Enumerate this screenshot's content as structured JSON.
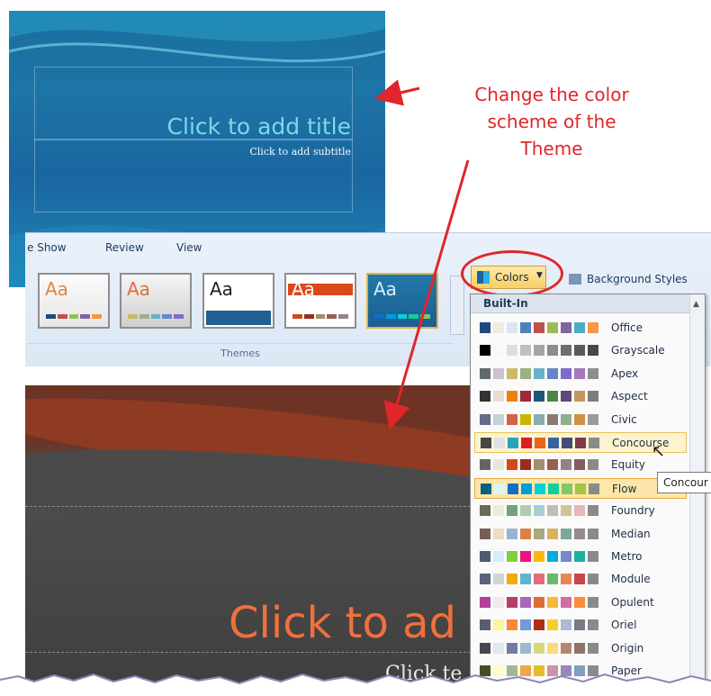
{
  "top_slide": {
    "title": "Click to add title",
    "subtitle": "Click to add subtitle"
  },
  "annotation": {
    "line1": "Change the color",
    "line2": "scheme of the",
    "line3": "Theme",
    "color": "#e0262a"
  },
  "ribbon": {
    "tabs": [
      "e Show",
      "Review",
      "View"
    ],
    "themes_group_label": "Themes",
    "theme_thumbnail_text": "Aa",
    "colors_button_label": "Colors",
    "background_styles_label": "Background Styles"
  },
  "colors_menu": {
    "header": "Built-In",
    "schemes": [
      {
        "name": "Office",
        "colors": [
          "#1f497d",
          "#eeece1",
          "#dbe5f1",
          "#4f81bd",
          "#c0504d",
          "#9bbb59",
          "#8064a2",
          "#4bacc6",
          "#f79646"
        ]
      },
      {
        "name": "Grayscale",
        "colors": [
          "#000000",
          "#f8f8f8",
          "#dddddd",
          "#bfbfbf",
          "#a5a5a5",
          "#8c8c8c",
          "#6e6e6e",
          "#595959",
          "#474747"
        ]
      },
      {
        "name": "Apex",
        "colors": [
          "#5f6b6d",
          "#c9c2d1",
          "#ceb966",
          "#9cb084",
          "#6bb1c9",
          "#6585cf",
          "#7e6bc9",
          "#a379bb",
          "#8e8e8e"
        ]
      },
      {
        "name": "Aspect",
        "colors": [
          "#323232",
          "#e3ded1",
          "#f07f09",
          "#9f2936",
          "#1b587c",
          "#4e8542",
          "#604878",
          "#c19859",
          "#7d7d7d"
        ]
      },
      {
        "name": "Civic",
        "colors": [
          "#646b86",
          "#c5d1d7",
          "#d16349",
          "#ccb400",
          "#8cadae",
          "#8c7b70",
          "#8fb08c",
          "#d19049",
          "#9b9b9b"
        ]
      },
      {
        "name": "Concourse",
        "colors": [
          "#464646",
          "#dee0e4",
          "#2da2bf",
          "#da1f28",
          "#eb641b",
          "#39639d",
          "#474b78",
          "#7d3c4a",
          "#8a8a8a"
        ]
      },
      {
        "name": "Equity",
        "colors": [
          "#696464",
          "#e9e5dc",
          "#d34817",
          "#9b2d1f",
          "#a28e6a",
          "#956251",
          "#918485",
          "#855d5d",
          "#8a8a8a"
        ]
      },
      {
        "name": "Flow",
        "colors": [
          "#04617b",
          "#dbf5f9",
          "#0f6fc6",
          "#009dd9",
          "#0bd0d9",
          "#10cf9b",
          "#7cca62",
          "#a5c249",
          "#8a8a8a"
        ]
      },
      {
        "name": "Foundry",
        "colors": [
          "#676a55",
          "#eaebde",
          "#72a376",
          "#b0ccb0",
          "#a8cdd7",
          "#c0beaf",
          "#cec597",
          "#e8b7b7",
          "#8a8a8a"
        ]
      },
      {
        "name": "Median",
        "colors": [
          "#775f55",
          "#ebddc3",
          "#94b6d2",
          "#dd8047",
          "#a5ab81",
          "#d8b25c",
          "#7ba79d",
          "#968c8c",
          "#8a8a8a"
        ]
      },
      {
        "name": "Metro",
        "colors": [
          "#4e5b6f",
          "#d6ecff",
          "#7fd13b",
          "#ea157a",
          "#feb80a",
          "#00addc",
          "#738ac8",
          "#1ab39f",
          "#8a8a8a"
        ]
      },
      {
        "name": "Module",
        "colors": [
          "#5a6378",
          "#d4d4d6",
          "#f0ad00",
          "#60b5cc",
          "#e66c7d",
          "#6bb76d",
          "#e88651",
          "#c64847",
          "#8a8a8a"
        ]
      },
      {
        "name": "Opulent",
        "colors": [
          "#b13f9a",
          "#f4e7ed",
          "#b83d68",
          "#ac66bb",
          "#de6c36",
          "#f9b639",
          "#cf6da4",
          "#fa8d3d",
          "#8a8a8a"
        ]
      },
      {
        "name": "Oriel",
        "colors": [
          "#575f6d",
          "#fff39d",
          "#fe8637",
          "#7598d9",
          "#b32c16",
          "#f5cd2d",
          "#aebad5",
          "#777c84",
          "#8a8a8a"
        ]
      },
      {
        "name": "Origin",
        "colors": [
          "#464653",
          "#dde9ec",
          "#727ca3",
          "#9fb8cd",
          "#d2da7a",
          "#fada7a",
          "#b88472",
          "#8e736a",
          "#8a8a8a"
        ]
      },
      {
        "name": "Paper",
        "colors": [
          "#444d26",
          "#fefac9",
          "#a5b592",
          "#f3a447",
          "#e7bc29",
          "#d092a7",
          "#9c85c0",
          "#809ec2",
          "#8a8a8a"
        ]
      }
    ],
    "hovered": "Concourse",
    "selected": "Flow"
  },
  "tooltip": "Concour",
  "bottom_slide": {
    "title": "Click to ad",
    "subtitle": "Click te"
  }
}
